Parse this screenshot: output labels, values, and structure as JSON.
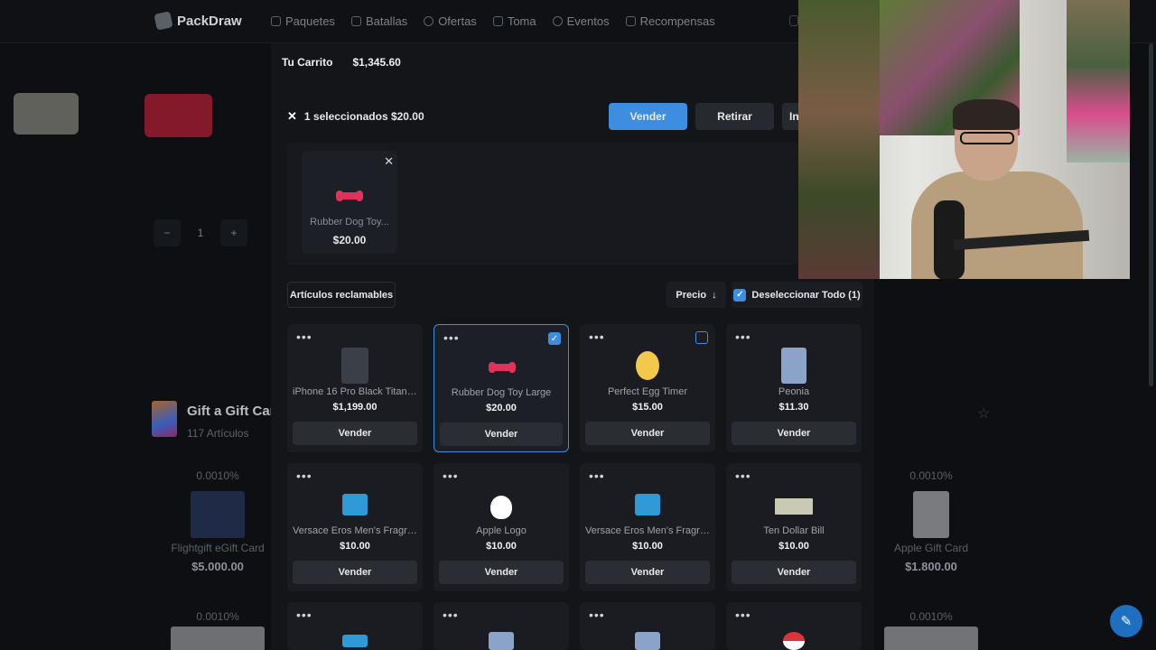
{
  "nav": {
    "brand": "PackDraw",
    "items": [
      {
        "label": "Paquetes",
        "icon": "box-icon"
      },
      {
        "label": "Batallas",
        "icon": "swords-icon"
      },
      {
        "label": "Ofertas",
        "icon": "tag-icon"
      },
      {
        "label": "Toma",
        "icon": "grab-icon"
      },
      {
        "label": "Eventos",
        "icon": "calendar-icon"
      },
      {
        "label": "Recompensas",
        "icon": "gift-icon"
      }
    ]
  },
  "background": {
    "quantity": "1",
    "minus": "−",
    "plus": "+",
    "category_title": "Gift a Gift Car",
    "category_count": "117 Artículos",
    "items": [
      {
        "odds": "0.0010%",
        "name": "Flightgift eGift Card",
        "price": "$5.000.00"
      },
      {
        "odds": "0.0010%",
        "name": "Apple Gift Card",
        "price": "$1.800.00"
      },
      {
        "odds": "0.0010%"
      },
      {
        "odds": "0.0010%"
      }
    ],
    "colors": {
      "flightgift": "#2b3c6b",
      "apple": "#e5e7ea",
      "target": "#c41e3a"
    }
  },
  "cart": {
    "label": "Tu Carrito",
    "total": "$1,345.60",
    "selection_text": "1 seleccionados $20.00",
    "sell_button": "Vender",
    "withdraw_button": "Retirar",
    "more_button": "In",
    "selected_item": {
      "name": "Rubber Dog Toy...",
      "price": "$20.00"
    },
    "claimable_label": "Artículos reclamables",
    "sort_label": "Precio",
    "deselect_label": "Deseleccionar Todo (1)",
    "accent": "#3d8ee0",
    "items": [
      {
        "name": "iPhone 16 Pro Black Titaniu...",
        "price": "$1,199.00",
        "action": "Vender",
        "selected": false,
        "color": "#3a3f48"
      },
      {
        "name": "Rubber Dog Toy Large",
        "price": "$20.00",
        "action": "Vender",
        "selected": true,
        "color": "#e0325a"
      },
      {
        "name": "Perfect Egg Timer",
        "price": "$15.00",
        "action": "Vender",
        "selected": false,
        "color": "#f2c94c"
      },
      {
        "name": "Peonia",
        "price": "$11.30",
        "action": "Vender",
        "selected": false,
        "color": "#8aa3c7"
      },
      {
        "name": "Versace Eros Men's Fragra...",
        "price": "$10.00",
        "action": "Vender",
        "selected": false,
        "color": "#2f9ad6"
      },
      {
        "name": "Apple Logo",
        "price": "$10.00",
        "action": "Vender",
        "selected": false,
        "color": "#ffffff"
      },
      {
        "name": "Versace Eros Men's Fragra...",
        "price": "$10.00",
        "action": "Vender",
        "selected": false,
        "color": "#2f9ad6"
      },
      {
        "name": "Ten Dollar Bill",
        "price": "$10.00",
        "action": "Vender",
        "selected": false,
        "color": "#c9c9b4"
      }
    ]
  }
}
